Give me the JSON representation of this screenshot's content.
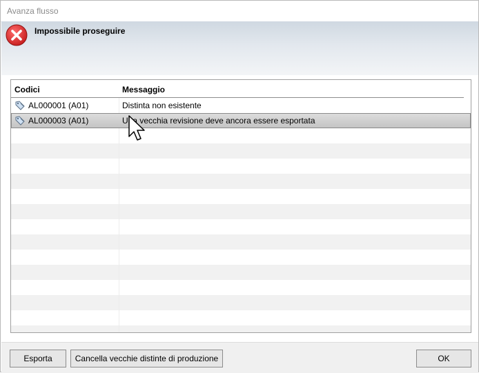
{
  "window": {
    "title": "Avanza flusso"
  },
  "header": {
    "message": "Impossibile proseguire",
    "icon": "error-x-icon"
  },
  "grid": {
    "columns": [
      "Codici",
      "Messaggio"
    ],
    "rows": [
      {
        "code": "AL000001 (A01)",
        "message": "Distinta non esistente",
        "selected": false
      },
      {
        "code": "AL000003 (A01)",
        "message": "Una vecchia revisione deve ancora essere esportata",
        "selected": true
      }
    ]
  },
  "footer": {
    "export_label": "Esporta",
    "delete_label": "Cancella vecchie distinte di produzione",
    "ok_label": "OK"
  },
  "colors": {
    "error": "#d92b2b",
    "selection": "#cfcfcf",
    "header_band": "#dfe5eb"
  }
}
